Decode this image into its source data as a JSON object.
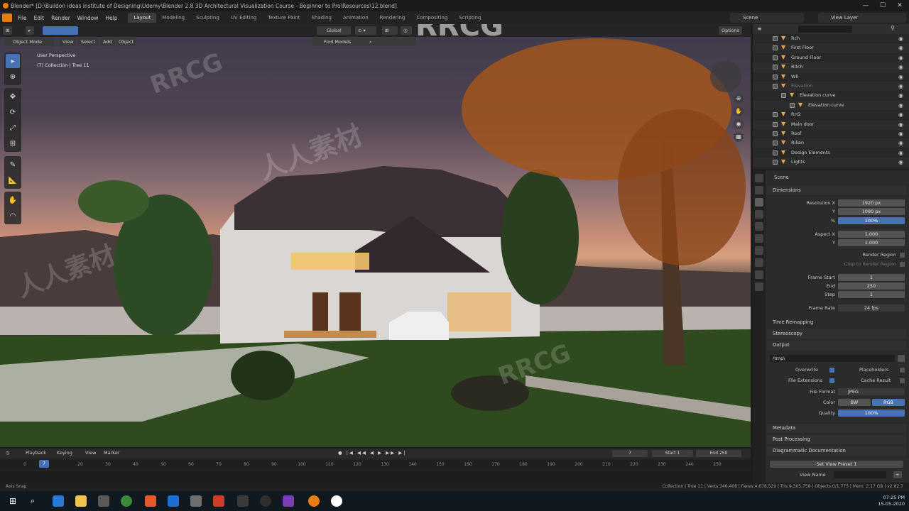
{
  "window": {
    "title": "Blender* [D:\\Buildon ideas institute of Designing\\Udemy\\Blender 2.8 3D Architectural Visualization Course - Beginner to Pro\\Resources\\12.blend]",
    "minimize": "—",
    "maximize": "☐",
    "close": "✕"
  },
  "menus": [
    "File",
    "Edit",
    "Render",
    "Window",
    "Help"
  ],
  "workspaces": [
    "Layout",
    "Modeling",
    "Sculpting",
    "UV Editing",
    "Texture Paint",
    "Shading",
    "Animation",
    "Rendering",
    "Compositing",
    "Scripting"
  ],
  "active_workspace": "Layout",
  "scene_field": "Scene",
  "view_layer_field": "View Layer",
  "viewport": {
    "mode": "Object Mode",
    "menus": [
      "View",
      "Select",
      "Add",
      "Object"
    ],
    "orientation": "Global",
    "find_models": "Find Models",
    "options": "Options",
    "view_name": "User Perspective",
    "collection_info": "(7) Collection | Tree 11"
  },
  "watermarks": [
    "RRCG",
    "RRCG",
    "人人素材",
    "RRCG",
    "人人素材"
  ],
  "outliner": {
    "search_placeholder": "",
    "rows": [
      {
        "name": "Rch",
        "dim": false
      },
      {
        "name": "First Floor",
        "dim": false
      },
      {
        "name": "Ground Floor",
        "dim": false
      },
      {
        "name": "Ritch",
        "dim": false
      },
      {
        "name": "Wll",
        "dim": false
      },
      {
        "name": "Elevation",
        "dim": true
      },
      {
        "name": "Elevation curve",
        "dim": false
      },
      {
        "name": "Elevation curve",
        "dim": false
      },
      {
        "name": "Rrt2",
        "dim": false
      },
      {
        "name": "Main door",
        "dim": false
      },
      {
        "name": "Roof",
        "dim": false
      },
      {
        "name": "Rilian",
        "dim": false
      },
      {
        "name": "Design Elements",
        "dim": false
      },
      {
        "name": "Lights",
        "dim": false
      }
    ]
  },
  "properties": {
    "header": "Scene",
    "dimensions_label": "Dimensions",
    "resolution_x_label": "Resolution X",
    "resolution_x": "1920 px",
    "y_label": "Y",
    "resolution_y": "1080 px",
    "percent_label": "%",
    "percent": "100%",
    "aspect_x_label": "Aspect X",
    "aspect_x": "1.000",
    "aspect_y": "1.000",
    "render_region": "Render Region",
    "crop_region": "Crop to Render Region",
    "frame_start_label": "Frame Start",
    "frame_start": "1",
    "end_label": "End",
    "frame_end": "250",
    "step_label": "Step",
    "frame_step": "1",
    "frame_rate_label": "Frame Rate",
    "frame_rate": "24 fps",
    "time_remapping": "Time Remapping",
    "stereoscopy": "Stereoscopy",
    "output_label": "Output",
    "output_path": "/tmp\\",
    "overwrite": "Overwrite",
    "placeholders": "Placeholders",
    "file_extensions": "File Extensions",
    "cache_result": "Cache Result",
    "file_format_label": "File Format",
    "file_format": "JPEG",
    "color_label": "Color",
    "color_bw": "BW",
    "color_rgb": "RGB",
    "quality_label": "Quality",
    "quality": "100%",
    "metadata": "Metadata",
    "post_processing": "Post Processing",
    "archimesh_docs": "Diagrammatic Documentation",
    "set_view_preset": "Set View Preset 1",
    "view_name_label": "View Name"
  },
  "timeline": {
    "menus": [
      "Playback",
      "Keying",
      "View",
      "Marker"
    ],
    "current_frame": "7",
    "start_label": "Start",
    "start": "1",
    "end_label": "End",
    "end": "250",
    "ticks": [
      "0",
      "20",
      "30",
      "40",
      "50",
      "60",
      "70",
      "80",
      "90",
      "100",
      "110",
      "120",
      "130",
      "140",
      "150",
      "160",
      "170",
      "180",
      "190",
      "200",
      "210",
      "220",
      "230",
      "240",
      "250"
    ],
    "playhead": "7"
  },
  "statusbar": {
    "left": "Axis Snap",
    "right": "Collection | Tree 11 | Verts:346,408 | Faces:4,678,529 | Tris:9,305,758 | Objects:0/1,775 | Mem: 2.17 GB | v2.82.7"
  },
  "taskbar": {
    "clock_time": "07:25 PM",
    "clock_date": "15-05-2020"
  }
}
